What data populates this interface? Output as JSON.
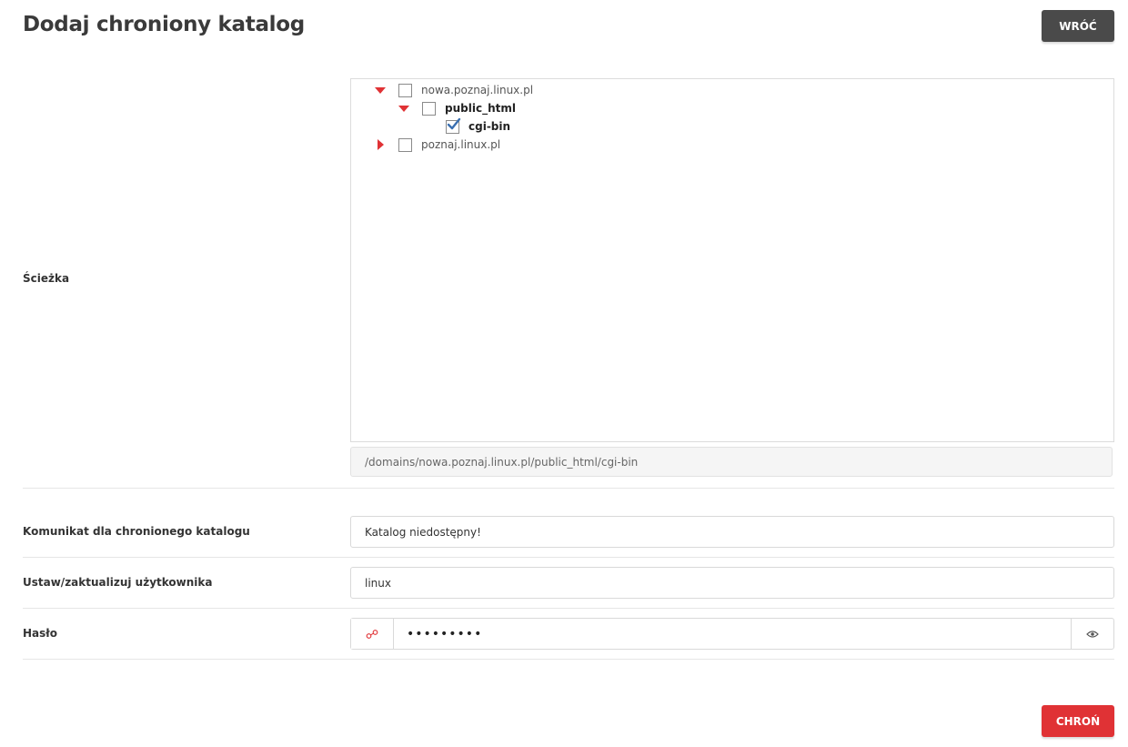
{
  "header": {
    "title": "Dodaj chroniony katalog",
    "back_label": "WRÓĆ"
  },
  "path_section": {
    "label": "Ścieżka",
    "tree": [
      {
        "label": "nowa.poznaj.linux.pl",
        "expanded": true,
        "checked": false,
        "bold": false
      },
      {
        "label": "public_html",
        "expanded": true,
        "checked": false,
        "bold": true
      },
      {
        "label": "cgi-bin",
        "checked": true,
        "bold": true
      },
      {
        "label": "poznaj.linux.pl",
        "expanded": false,
        "checked": false,
        "bold": false
      }
    ],
    "selected_path": "/domains/nowa.poznaj.linux.pl/public_html/cgi-bin"
  },
  "message": {
    "label": "Komunikat dla chronionego katalogu",
    "value": "Katalog niedostępny!"
  },
  "user": {
    "label": "Ustaw/zaktualizuj użytkownika",
    "value": "linux"
  },
  "password": {
    "label": "Hasło",
    "value": "•••••••••",
    "generate_icon": "key-generate-icon",
    "toggle_icon": "eye-icon"
  },
  "footer": {
    "submit_label": "CHROŃ"
  },
  "colors": {
    "accent": "#e03235",
    "dark_button": "#4a4a4a",
    "check": "#3a6fb0"
  }
}
